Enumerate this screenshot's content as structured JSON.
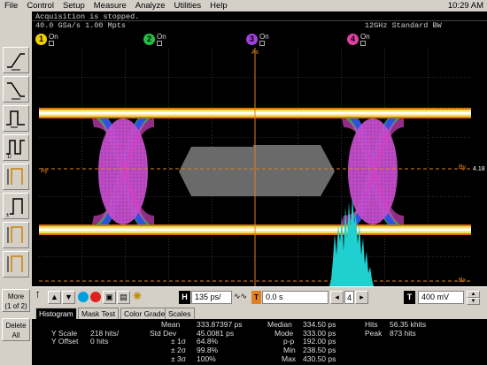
{
  "menu": {
    "items": [
      "File",
      "Control",
      "Setup",
      "Measure",
      "Analyze",
      "Utilities",
      "Help"
    ],
    "clock": "10:29 AM"
  },
  "status": {
    "line1": "Acquisition is stopped.",
    "line2": "40.0 GSa/s   1.00 Mpts",
    "bandwidth": "12GHz Standard BW"
  },
  "channels": [
    {
      "num": "1",
      "label": "On",
      "color": "#f0d000"
    },
    {
      "num": "2",
      "label": "On",
      "color": "#20c040"
    },
    {
      "num": "3",
      "label": "On",
      "color": "#a040e0"
    },
    {
      "num": "4",
      "label": "On",
      "color": "#e040a0"
    }
  ],
  "toolbar": {
    "more_line1": "More",
    "more_line2": "(1 of 2)",
    "delete_line1": "Delete",
    "delete_line2": "All"
  },
  "markers": {
    "ax": "Ax",
    "bx": "Bx",
    "ay": "Ay",
    "by": "By",
    "right_ref": "4.18"
  },
  "control": {
    "h_label": "H",
    "h_value": "135 ps/",
    "t_label": "T",
    "t_value": "0.0 s",
    "trig_ch": "4",
    "v_label": "T",
    "v_value": "400 mV"
  },
  "tabs": [
    "Histogram",
    "Mask Test",
    "Color Grade",
    "Scales"
  ],
  "meas": {
    "yscale_label": "Y Scale",
    "yscale_value": "218 hits/",
    "yoffset_label": "Y Offset",
    "yoffset_value": "0 hits",
    "mean_label": "Mean",
    "mean_value": "333.87397 ps",
    "stddev_label": "Std Dev",
    "stddev_value": "45.0081 ps",
    "s1_label": "± 1σ",
    "s1_value": "64.8%",
    "s2_label": "± 2σ",
    "s2_value": "99.8%",
    "s3_label": "± 3σ",
    "s3_value": "100%",
    "median_label": "Median",
    "median_value": "334.50 ps",
    "mode_label": "Mode",
    "mode_value": "333.00 ps",
    "pp_label": "p-p",
    "pp_value": "192.00 ps",
    "min_label": "Min",
    "min_value": "238.50 ps",
    "max_label": "Max",
    "max_value": "430.50 ps",
    "hits_label": "Hits",
    "hits_value": "56.35 khits",
    "peak_label": "Peak",
    "peak_value": "873 hits"
  },
  "colors": {
    "background": "#000000",
    "grid": "#5a5a5a",
    "marker": "#e08020",
    "histogram": "#20d0d0"
  }
}
